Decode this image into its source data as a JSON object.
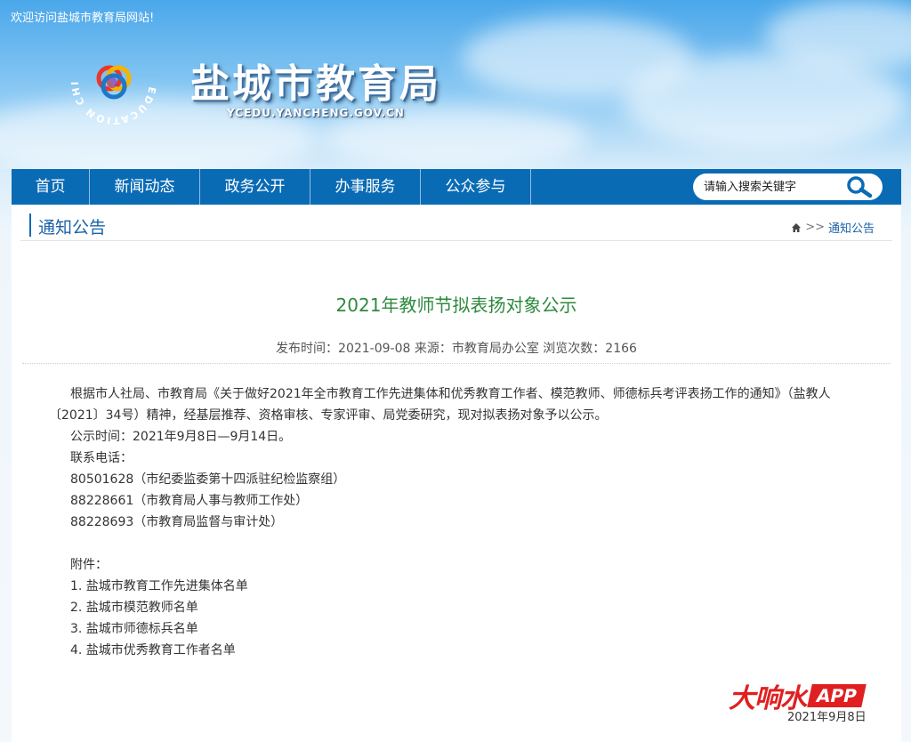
{
  "header": {
    "welcome": "欢迎访问盐城市教育局网站!",
    "site_title": "盐城市教育局",
    "site_url": "YCEDU.YANCHENG.GOV.CN",
    "logo_ring_text": "EDUCATION CHINA YANCHENG"
  },
  "nav": {
    "items": [
      {
        "label": "首页"
      },
      {
        "label": "新闻动态"
      },
      {
        "label": "政务公开"
      },
      {
        "label": "办事服务"
      },
      {
        "label": "公众参与"
      }
    ],
    "search_placeholder": "请输入搜索关键字"
  },
  "section": {
    "title": "通知公告",
    "breadcrumb_sep": ">>",
    "breadcrumb_current": "通知公告"
  },
  "article": {
    "title": "2021年教师节拟表扬对象公示",
    "meta": "发布时间：2021-09-08 来源：市教育局办公室 浏览次数：2166",
    "intro": "根据市人社局、市教育局《关于做好2021年全市教育工作先进集体和优秀教育工作者、模范教师、师德标兵考评表扬工作的通知》（盐教人〔2021〕34号）精神，经基层推荐、资格审核、专家评审、局党委研究，现对拟表扬对象予以公示。",
    "period": "公示时间：2021年9月8日—9月14日。",
    "contact_label": "联系电话：",
    "phones": [
      "80501628（市纪委监委第十四派驻纪检监察组）",
      "88228661（市教育局人事与教师工作处）",
      "88228693（市教育局监督与审计处）"
    ],
    "attachment_label": "附件：",
    "attachments": [
      "1. 盐城市教育工作先进集体名单",
      "2. 盐城市模范教师名单",
      "3. 盐城市师德标兵名单",
      "4. 盐城市优秀教育工作者名单"
    ],
    "footer_date": "2021年9月8日"
  },
  "watermark": {
    "brand": "大响水",
    "app": "APP"
  },
  "colors": {
    "nav_blue": "#0a6bb5",
    "title_green": "#2e8a3f",
    "link_blue": "#1a63a8",
    "watermark_red": "#e02020"
  }
}
